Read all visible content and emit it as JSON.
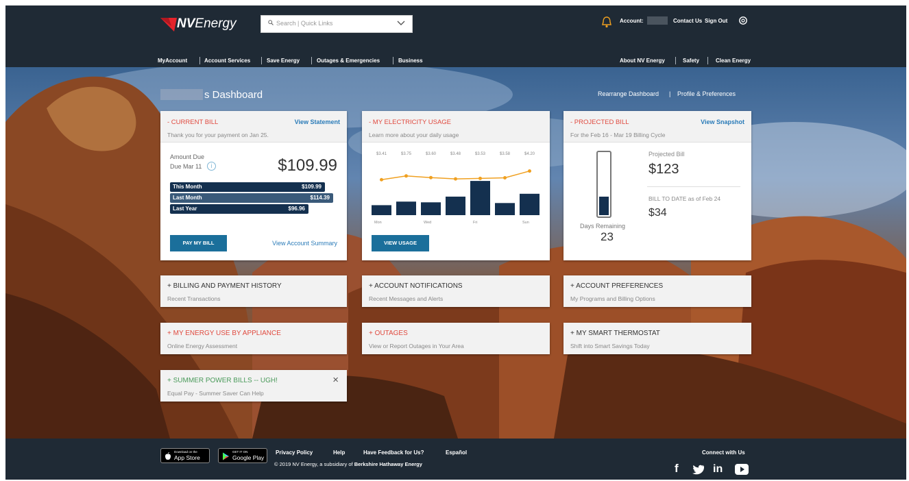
{
  "brand": {
    "logo_text_bold": "NV",
    "logo_text_rest": "Energy",
    "accent_color": "#e4232b"
  },
  "search": {
    "placeholder": "Search | Quick Links"
  },
  "header": {
    "account_label": "Account:",
    "contact_us": "Contact Us",
    "sign_out": "Sign Out",
    "nav_left": [
      "MyAccount",
      "Account Services",
      "Save Energy",
      "Outages & Emergencies",
      "Business"
    ],
    "nav_right": [
      "About NV Energy",
      "Safety",
      "Clean Energy"
    ]
  },
  "dashboard": {
    "title": "s Dashboard",
    "rearrange": "Rearrange Dashboard",
    "profile": "Profile & Preferences"
  },
  "current_bill": {
    "title": "- CURRENT BILL",
    "link": "View Statement",
    "subtitle": "Thank you for your payment on Jan 25.",
    "amount_label": "Amount Due",
    "due_label": "Due Mar 11",
    "info": "i",
    "amount": "$109.99",
    "rows": [
      {
        "label": "This Month",
        "value": "$109.99",
        "fraction": 0.95
      },
      {
        "label": "Last Month",
        "value": "$114.39",
        "fraction": 1.0
      },
      {
        "label": "Last Year",
        "value": "$96.96",
        "fraction": 0.85
      }
    ],
    "button": "PAY MY BILL",
    "summary_link": "View Account Summary"
  },
  "usage": {
    "title": "- MY ELECTRICITY USAGE",
    "subtitle": "Learn more about your daily usage",
    "button": "VIEW USAGE",
    "price_labels": [
      "$3.41",
      "$3.75",
      "$3.60",
      "$3.48",
      "$3.53",
      "$3.58",
      "$4.20"
    ],
    "day_labels": [
      "Mon",
      "Wed",
      "Fri",
      "Sun"
    ]
  },
  "chart_data": {
    "type": "bar",
    "categories": [
      "1",
      "2",
      "3",
      "4",
      "5",
      "6",
      "7"
    ],
    "series": [
      {
        "values": [
          14,
          19,
          18,
          26,
          48,
          17,
          30
        ]
      },
      {
        "values": [
          3.41,
          3.75,
          3.6,
          3.48,
          3.53,
          3.58,
          4.2
        ]
      }
    ],
    "x_tick_labels": [
      "Mon",
      "Wed",
      "Fri",
      "Sun"
    ],
    "colors": {
      "bars": "#14304f",
      "line": "#f0a020"
    }
  },
  "projected": {
    "title": "- PROJECTED BILL",
    "link": "View Snapshot",
    "subtitle": "For the Feb 16 - Mar 19 Billing Cycle",
    "projected_label": "Projected Bill",
    "projected_value": "$123",
    "btd_label": "BILL TO DATE as of Feb 24",
    "btd_value": "$34",
    "days_label": "Days Remaining",
    "days_value": "23",
    "fill_fraction": 0.3
  },
  "small_cards": [
    {
      "title": "+ BILLING AND PAYMENT HISTORY",
      "subtitle": "Recent Transactions",
      "tone": "dark"
    },
    {
      "title": "+ ACCOUNT NOTIFICATIONS",
      "subtitle": "Recent Messages and Alerts",
      "tone": "dark"
    },
    {
      "title": "+ ACCOUNT PREFERENCES",
      "subtitle": "My Programs and Billing Options",
      "tone": "dark"
    },
    {
      "title": "+ MY ENERGY USE BY APPLIANCE",
      "subtitle": "Online Energy Assessment",
      "tone": "red"
    },
    {
      "title": "+ OUTAGES",
      "subtitle": "View or Report Outages in Your Area",
      "tone": "red"
    },
    {
      "title": "+ MY SMART THERMOSTAT",
      "subtitle": "Shift into Smart Savings Today",
      "tone": "dark"
    },
    {
      "title": "+ SUMMER POWER BILLS -- UGH!",
      "subtitle": "Equal Pay - Summer Saver Can Help",
      "tone": "green",
      "close": "×"
    }
  ],
  "footer": {
    "app_store_small": "Download on the",
    "app_store": "App Store",
    "google_small": "GET IT ON",
    "google_play": "Google Play",
    "links": [
      "Privacy Policy",
      "Help",
      "Have Feedback for Us?",
      "Español"
    ],
    "copyright_pre": "© 2019 NV Energy, a subsidiary of ",
    "copyright_bold": "Berkshire Hathaway Energy",
    "connect": "Connect with Us",
    "social": {
      "facebook": "f",
      "linkedin": "in"
    }
  }
}
